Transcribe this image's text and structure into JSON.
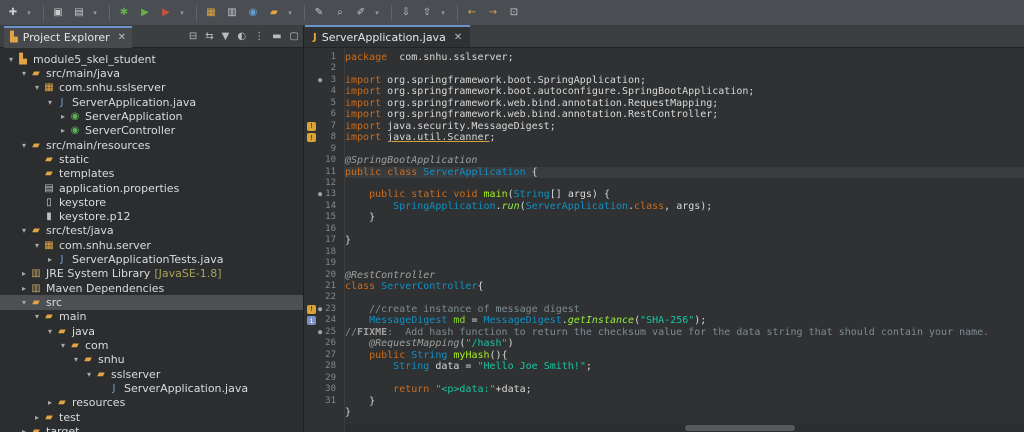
{
  "toolbar": {
    "icons": [
      "new-icon",
      "save-icon",
      "save-all-icon",
      "debug-icon",
      "run-icon",
      "external-tools-icon",
      "new-java-project-icon",
      "new-package-icon",
      "new-class-icon",
      "open-type-icon",
      "open-task-icon",
      "search-icon",
      "toggle-mark-icon",
      "next-annotation-icon",
      "prev-annotation-icon",
      "back-icon",
      "forward-icon",
      "pin-editor-icon"
    ]
  },
  "explorer": {
    "title": "Project Explorer",
    "items": [
      {
        "label": "module5_skel_student",
        "icon": "project-icon",
        "twisty": "⌄",
        "depth": 0
      },
      {
        "label": "src/main/java",
        "icon": "source-folder-icon",
        "twisty": "⌄",
        "depth": 1
      },
      {
        "label": "com.snhu.sslserver",
        "icon": "package-icon",
        "twisty": "⌄",
        "depth": 2
      },
      {
        "label": "ServerApplication.java",
        "icon": "java-file-icon",
        "twisty": "⌄",
        "depth": 3
      },
      {
        "label": "ServerApplication",
        "icon": "class-icon",
        "twisty": "›",
        "depth": 4
      },
      {
        "label": "ServerController",
        "icon": "class-icon",
        "twisty": "›",
        "depth": 4
      },
      {
        "label": "src/main/resources",
        "icon": "source-folder-icon",
        "twisty": "⌄",
        "depth": 1
      },
      {
        "label": "static",
        "icon": "folder-icon",
        "twisty": "",
        "depth": 2
      },
      {
        "label": "templates",
        "icon": "folder-icon",
        "twisty": "",
        "depth": 2
      },
      {
        "label": "application.properties",
        "icon": "properties-file-icon",
        "twisty": "",
        "depth": 2
      },
      {
        "label": "keystore",
        "icon": "file-icon",
        "twisty": "",
        "depth": 2
      },
      {
        "label": "keystore.p12",
        "icon": "keystore-file-icon",
        "twisty": "",
        "depth": 2
      },
      {
        "label": "src/test/java",
        "icon": "source-folder-icon",
        "twisty": "⌄",
        "depth": 1
      },
      {
        "label": "com.snhu.server",
        "icon": "package-icon",
        "twisty": "⌄",
        "depth": 2
      },
      {
        "label": "ServerApplicationTests.java",
        "icon": "java-file-icon",
        "twisty": "›",
        "depth": 3
      },
      {
        "label": "JRE System Library",
        "deco": "[JavaSE-1.8]",
        "icon": "library-icon",
        "twisty": "›",
        "depth": 1
      },
      {
        "label": "Maven Dependencies",
        "icon": "library-icon",
        "twisty": "›",
        "depth": 1
      },
      {
        "label": "src",
        "icon": "folder-icon",
        "twisty": "⌄",
        "depth": 1,
        "selected": true
      },
      {
        "label": "main",
        "icon": "folder-icon",
        "twisty": "⌄",
        "depth": 2
      },
      {
        "label": "java",
        "icon": "folder-icon",
        "twisty": "⌄",
        "depth": 3
      },
      {
        "label": "com",
        "icon": "folder-icon",
        "twisty": "⌄",
        "depth": 4
      },
      {
        "label": "snhu",
        "icon": "folder-icon",
        "twisty": "⌄",
        "depth": 5
      },
      {
        "label": "sslserver",
        "icon": "folder-icon",
        "twisty": "⌄",
        "depth": 6
      },
      {
        "label": "ServerApplication.java",
        "icon": "java-file-icon",
        "twisty": "",
        "depth": 7
      },
      {
        "label": "resources",
        "icon": "folder-icon",
        "twisty": "›",
        "depth": 3
      },
      {
        "label": "test",
        "icon": "folder-icon",
        "twisty": "›",
        "depth": 2
      },
      {
        "label": "target",
        "icon": "folder-icon",
        "twisty": "›",
        "depth": 1
      }
    ]
  },
  "editor": {
    "tab_label": "ServerApplication.java",
    "lines": [
      {
        "n": "1",
        "tokens": [
          [
            "kw",
            "package"
          ],
          [
            "",
            "  com.snhu.sslserver;"
          ]
        ]
      },
      {
        "n": "2",
        "tokens": []
      },
      {
        "n": "3",
        "fold": "⊖",
        "tokens": [
          [
            "kw",
            "import"
          ],
          [
            "",
            " org.springframework.boot.SpringApplication;"
          ]
        ]
      },
      {
        "n": "4",
        "tokens": [
          [
            "kw",
            "import"
          ],
          [
            "",
            " org.springframework.boot.autoconfigure.SpringBootApplication;"
          ]
        ]
      },
      {
        "n": "5",
        "tokens": [
          [
            "kw",
            "import"
          ],
          [
            "",
            " org.springframework.web.bind.annotation.RequestMapping;"
          ]
        ]
      },
      {
        "n": "6",
        "tokens": [
          [
            "kw",
            "import"
          ],
          [
            "",
            " org.springframework.web.bind.annotation.RestController;"
          ]
        ]
      },
      {
        "n": "7",
        "marker": "warn",
        "tokens": [
          [
            "kw",
            "import"
          ],
          [
            "",
            " java.security.MessageDigest;"
          ]
        ]
      },
      {
        "n": "8",
        "marker": "warn",
        "tokens": [
          [
            "kw",
            "import"
          ],
          [
            "",
            " "
          ],
          [
            "und",
            "java.util.Scanner"
          ],
          [
            "",
            ";"
          ]
        ]
      },
      {
        "n": "9",
        "tokens": []
      },
      {
        "n": "10",
        "tokens": [
          [
            "ann",
            "@SpringBootApplication"
          ]
        ]
      },
      {
        "n": "11",
        "tokens": [
          [
            "kw",
            "public"
          ],
          [
            "",
            " "
          ],
          [
            "kw",
            "class"
          ],
          [
            "",
            " "
          ],
          [
            "ty",
            "ServerApplication"
          ],
          [
            "",
            " {"
          ]
        ]
      },
      {
        "n": "12",
        "tokens": []
      },
      {
        "n": "13",
        "fold": "⊖",
        "tokens": [
          [
            "",
            "    "
          ],
          [
            "kw",
            "public"
          ],
          [
            "",
            " "
          ],
          [
            "kw",
            "static"
          ],
          [
            "",
            " "
          ],
          [
            "kw",
            "void"
          ],
          [
            "",
            " "
          ],
          [
            "mth",
            "main"
          ],
          [
            "",
            "("
          ],
          [
            "ty",
            "String"
          ],
          [
            "",
            "[] args) {"
          ]
        ]
      },
      {
        "n": "14",
        "tokens": [
          [
            "",
            "        "
          ],
          [
            "ty",
            "SpringApplication"
          ],
          [
            "",
            "."
          ],
          [
            "sm",
            "run"
          ],
          [
            "",
            "("
          ],
          [
            "ty",
            "ServerApplication"
          ],
          [
            "",
            "."
          ],
          [
            "kw",
            "class"
          ],
          [
            "",
            ", args);"
          ]
        ]
      },
      {
        "n": "15",
        "tokens": [
          [
            "",
            "    }"
          ]
        ]
      },
      {
        "n": "16",
        "tokens": []
      },
      {
        "n": "17",
        "tokens": [
          [
            "",
            "}"
          ]
        ]
      },
      {
        "n": "18",
        "tokens": []
      },
      {
        "n": "19",
        "tokens": []
      },
      {
        "n": "20",
        "tokens": [
          [
            "ann",
            "@RestController"
          ]
        ]
      },
      {
        "n": "21",
        "tokens": [
          [
            "kw",
            "class"
          ],
          [
            "",
            " "
          ],
          [
            "ty",
            "ServerController"
          ],
          [
            "",
            "{"
          ]
        ]
      },
      {
        "n": "22",
        "tokens": []
      },
      {
        "n": "23",
        "marker": "warn",
        "fold": "⊖",
        "tokens": [
          [
            "com",
            "    //create instance of message digest"
          ]
        ]
      },
      {
        "n": "24",
        "marker": "info",
        "tokens": [
          [
            "",
            "    "
          ],
          [
            "ty",
            "MessageDigest"
          ],
          [
            "",
            " "
          ],
          [
            "fld",
            "md"
          ],
          [
            "",
            " = "
          ],
          [
            "ty",
            "MessageDigest"
          ],
          [
            "",
            "."
          ],
          [
            "sm",
            "getInstance"
          ],
          [
            "",
            "("
          ],
          [
            "str",
            "\"SHA-256\""
          ],
          [
            "",
            ");"
          ]
        ]
      },
      {
        "n": "25",
        "fold": "⊖",
        "tokens": [
          [
            "com",
            "//"
          ],
          [
            "todo",
            "FIXME"
          ],
          [
            "com",
            ":  Add hash function to return the checksum value for the data string that should contain your name."
          ]
        ]
      },
      {
        "n": "26",
        "tokens": [
          [
            "",
            "    "
          ],
          [
            "ann",
            "@RequestMapping"
          ],
          [
            "",
            "("
          ],
          [
            "str",
            "\"/hash\""
          ],
          [
            "",
            ")"
          ]
        ]
      },
      {
        "n": "27",
        "tokens": [
          [
            "",
            "    "
          ],
          [
            "kw",
            "public"
          ],
          [
            "",
            " "
          ],
          [
            "ty",
            "String"
          ],
          [
            "",
            " "
          ],
          [
            "mth",
            "myHash"
          ],
          [
            "",
            "(){"
          ]
        ]
      },
      {
        "n": "28",
        "tokens": [
          [
            "",
            "        "
          ],
          [
            "ty",
            "String"
          ],
          [
            "",
            " data = "
          ],
          [
            "str",
            "\"Hello Joe Smith!\""
          ],
          [
            "",
            ";"
          ]
        ]
      },
      {
        "n": "29",
        "tokens": []
      },
      {
        "n": "30",
        "tokens": [
          [
            "",
            "        "
          ],
          [
            "kw",
            "return"
          ],
          [
            "",
            " "
          ],
          [
            "str",
            "\"<p>data:\""
          ],
          [
            "",
            "+data;"
          ]
        ]
      },
      {
        "n": "31",
        "tokens": [
          [
            "",
            "    }"
          ]
        ]
      },
      {
        "n": "",
        "tokens": [
          [
            "",
            "}"
          ]
        ]
      }
    ]
  }
}
